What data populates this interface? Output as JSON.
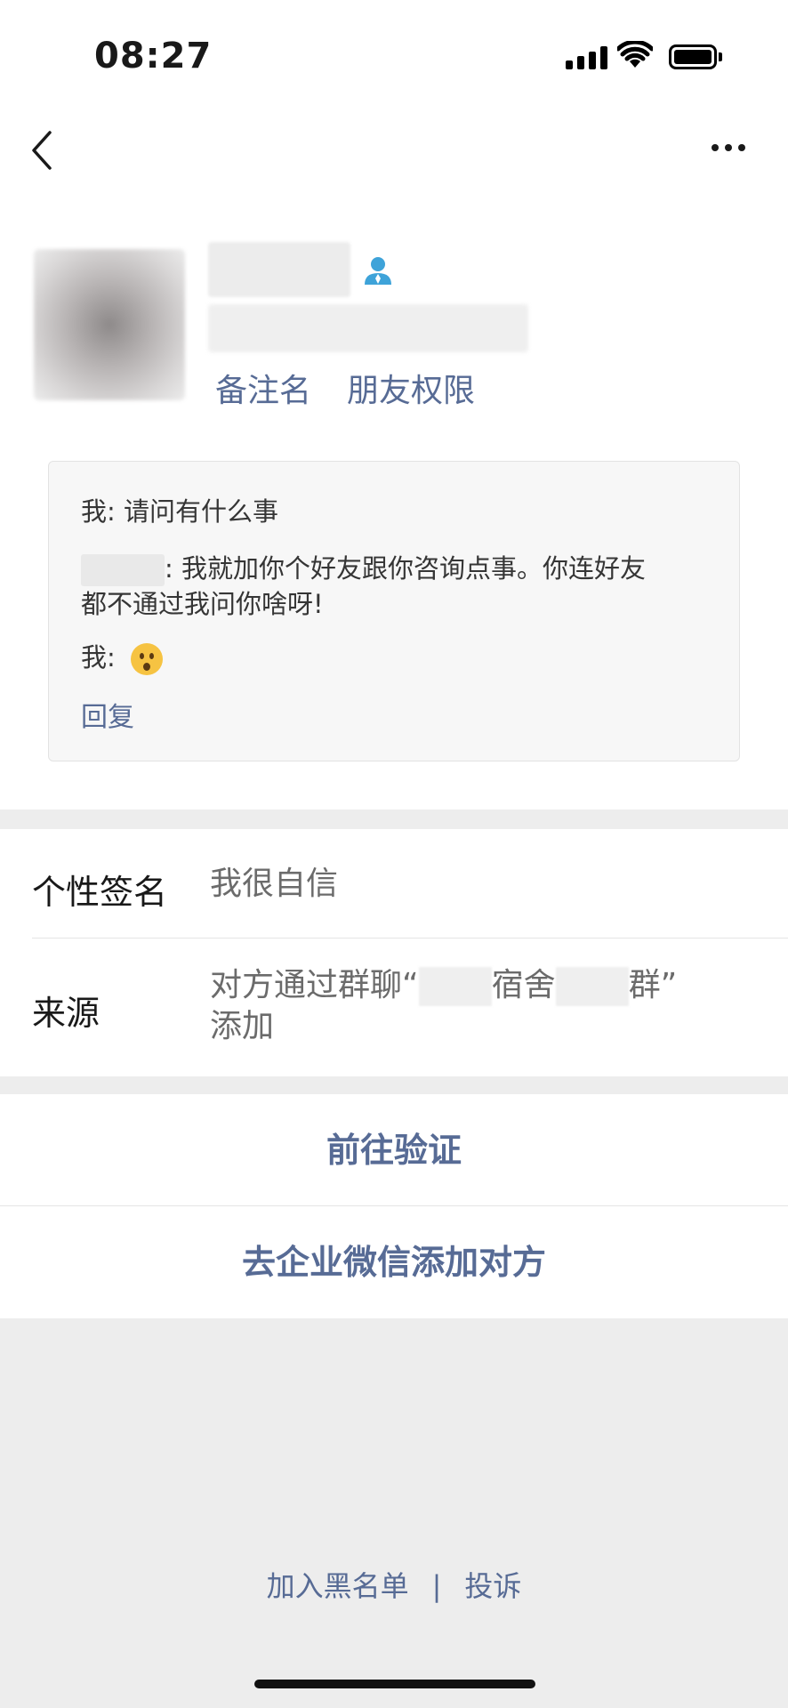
{
  "status_bar": {
    "time": "08:27"
  },
  "profile": {
    "links": [
      "备注名",
      "朋友权限"
    ]
  },
  "chat": {
    "lines": [
      {
        "prefix": "我: ",
        "text": "请问有什么事"
      },
      {
        "prefix": ": ",
        "text": "我就加你个好友跟你咨询点事。你连好友",
        "text2": "都不通过我问你啥呀!"
      },
      {
        "prefix": "我: ",
        "text": ""
      }
    ],
    "reply": "回复"
  },
  "info": {
    "signature_label": "个性签名",
    "signature_value": "我很自信",
    "source_label": "来源",
    "source_part1": "对方通过群聊“",
    "source_part2": "宿舍",
    "source_part3": "群”",
    "source_line2": "添加"
  },
  "actions": {
    "verify": "前往验证",
    "wecom": "去企业微信添加对方"
  },
  "footer": {
    "blacklist": "加入黑名单",
    "separator": "|",
    "report": "投诉"
  }
}
